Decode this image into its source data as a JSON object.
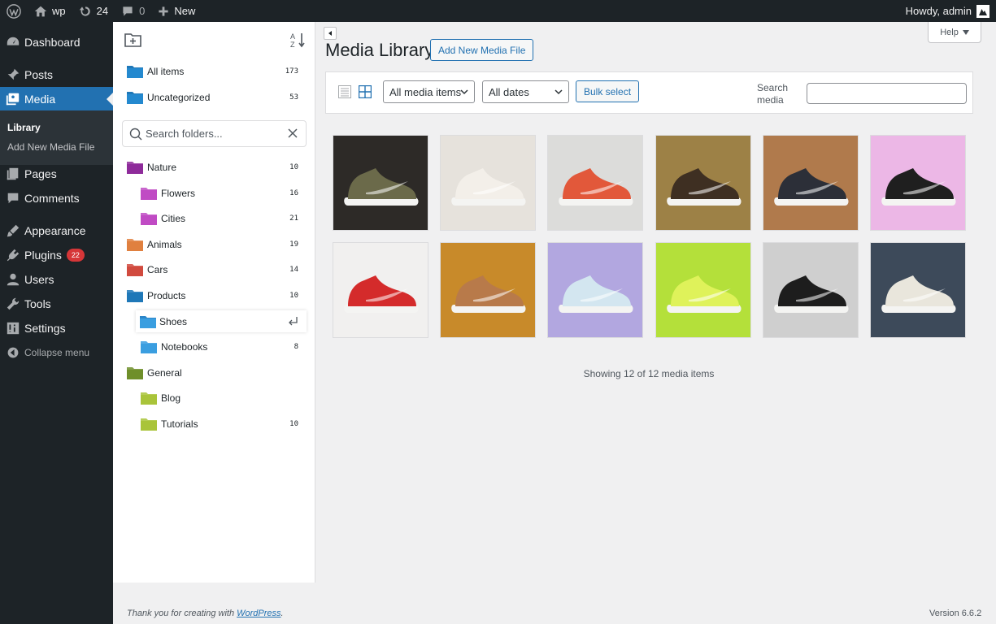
{
  "adminbar": {
    "site_name": "wp",
    "updates_count": "24",
    "comments_count": "0",
    "new_label": "New",
    "howdy": "Howdy, admin"
  },
  "sidebar": {
    "items": [
      {
        "label": "Dashboard",
        "icon": "dashboard-icon"
      },
      {
        "label": "Posts",
        "icon": "pin-icon"
      },
      {
        "label": "Media",
        "icon": "media-icon"
      },
      {
        "label": "Pages",
        "icon": "page-icon"
      },
      {
        "label": "Comments",
        "icon": "comment-icon"
      },
      {
        "label": "Appearance",
        "icon": "brush-icon"
      },
      {
        "label": "Plugins",
        "icon": "plugin-icon",
        "badge": "22"
      },
      {
        "label": "Users",
        "icon": "user-icon"
      },
      {
        "label": "Tools",
        "icon": "wrench-icon"
      },
      {
        "label": "Settings",
        "icon": "settings-icon"
      }
    ],
    "submenu": [
      "Library",
      "Add New Media File"
    ],
    "collapse_label": "Collapse menu"
  },
  "folders": {
    "all_items": {
      "label": "All items",
      "count": "173"
    },
    "uncategorized": {
      "label": "Uncategorized",
      "count": "53"
    },
    "search_placeholder": "Search folders...",
    "tree": [
      {
        "label": "Nature",
        "count": "10",
        "color": "#8e2b9a"
      },
      {
        "label": "Flowers",
        "count": "16",
        "color": "#c04bc4"
      },
      {
        "label": "Cities",
        "count": "21",
        "color": "#c04bc4"
      },
      {
        "label": "Animals",
        "count": "19",
        "color": "#e0803f"
      },
      {
        "label": "Cars",
        "count": "14",
        "color": "#d14a3e"
      },
      {
        "label": "Products",
        "count": "10",
        "color": "#1f78b8"
      },
      {
        "label": "Shoes",
        "count": "",
        "color": "#3a9ee0"
      },
      {
        "label": "Notebooks",
        "count": "8",
        "color": "#3a9ee0"
      },
      {
        "label": "General",
        "count": "",
        "color": "#6f8f2a"
      },
      {
        "label": "Blog",
        "count": "",
        "color": "#a9c43a"
      },
      {
        "label": "Tutorials",
        "count": "10",
        "color": "#a9c43a"
      }
    ],
    "rename_value": "Shoes"
  },
  "main": {
    "title": "Media Library",
    "add_new_label": "Add New Media File",
    "help_label": "Help",
    "filter_type": "All media items",
    "filter_date": "All dates",
    "bulk_label": "Bulk select",
    "search_label": "Search media",
    "search_value": "",
    "showing_text": "Showing 12 of 12 media items",
    "thumbnails": [
      {
        "name": "olive-green-new-balance-sneaker",
        "bg": "#2d2a27",
        "shoe": "#6b6a4a"
      },
      {
        "name": "white-sneaker-on-linen",
        "bg": "#e6e2dc",
        "shoe": "#f3efe9"
      },
      {
        "name": "orange-grey-nike-sneaker",
        "bg": "#dcdcda",
        "shoe": "#e2583a"
      },
      {
        "name": "dark-brown-sneaker-on-tan",
        "bg": "#9d8146",
        "shoe": "#3e2f22"
      },
      {
        "name": "black-converse-on-wood",
        "bg": "#b07a4c",
        "shoe": "#2c2f38"
      },
      {
        "name": "black-white-sneaker-on-pink",
        "bg": "#ecb7e6",
        "shoe": "#1f1f1f"
      },
      {
        "name": "red-jordan-sneaker",
        "bg": "#f1f0ef",
        "shoe": "#d42b2b"
      },
      {
        "name": "tan-nike-on-mustard",
        "bg": "#c88a2a",
        "shoe": "#b87a4a"
      },
      {
        "name": "pastel-nike-sneaker",
        "bg": "#b2a7e0",
        "shoe": "#d3e6f0"
      },
      {
        "name": "neon-green-nike-on-green",
        "bg": "#b4e03a",
        "shoe": "#dff25a"
      },
      {
        "name": "black-nike-air-force-grey",
        "bg": "#cfcfcf",
        "shoe": "#1d1d1d"
      },
      {
        "name": "colorful-sneaker-graffiti",
        "bg": "#3d4a5a",
        "shoe": "#e9e6dc"
      }
    ]
  },
  "footer": {
    "thanks_prefix": "Thank you for creating with ",
    "thanks_link": "WordPress",
    "thanks_suffix": ".",
    "version": "Version 6.6.2"
  }
}
